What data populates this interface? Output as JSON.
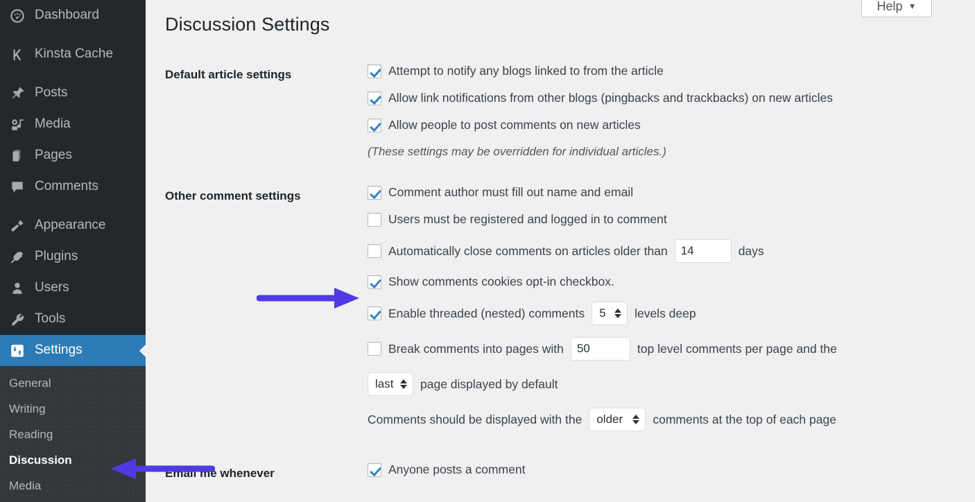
{
  "sidebar": {
    "items": [
      {
        "label": "Dashboard",
        "icon": "dashboard-icon",
        "current": false,
        "gap_after": true
      },
      {
        "label": "Kinsta Cache",
        "icon": "kinsta-k-icon",
        "current": false,
        "gap_after": true
      },
      {
        "label": "Posts",
        "icon": "pin-icon",
        "current": false,
        "gap_after": false
      },
      {
        "label": "Media",
        "icon": "media-icon",
        "current": false,
        "gap_after": false
      },
      {
        "label": "Pages",
        "icon": "pages-icon",
        "current": false,
        "gap_after": false
      },
      {
        "label": "Comments",
        "icon": "comment-icon",
        "current": false,
        "gap_after": true
      },
      {
        "label": "Appearance",
        "icon": "paintbrush-icon",
        "current": false,
        "gap_after": false
      },
      {
        "label": "Plugins",
        "icon": "plug-icon",
        "current": false,
        "gap_after": false
      },
      {
        "label": "Users",
        "icon": "user-icon",
        "current": false,
        "gap_after": false
      },
      {
        "label": "Tools",
        "icon": "wrench-icon",
        "current": false,
        "gap_after": false
      },
      {
        "label": "Settings",
        "icon": "sliders-icon",
        "current": true,
        "gap_after": false
      }
    ],
    "submenu": [
      {
        "label": "General",
        "active": false
      },
      {
        "label": "Writing",
        "active": false
      },
      {
        "label": "Reading",
        "active": false
      },
      {
        "label": "Discussion",
        "active": true
      },
      {
        "label": "Media",
        "active": false
      }
    ]
  },
  "header": {
    "help_label": "Help",
    "help_caret": "▼",
    "page_title": "Discussion Settings"
  },
  "sections": {
    "default_article": {
      "label": "Default article settings",
      "options": [
        {
          "text": "Attempt to notify any blogs linked to from the article",
          "checked": true
        },
        {
          "text": "Allow link notifications from other blogs (pingbacks and trackbacks) on new articles",
          "checked": true
        },
        {
          "text": "Allow people to post comments on new articles",
          "checked": true
        }
      ],
      "note": "(These settings may be overridden for individual articles.)"
    },
    "other_comment": {
      "label": "Other comment settings",
      "opt_author_fill": {
        "text": "Comment author must fill out name and email",
        "checked": true
      },
      "opt_registered": {
        "text": "Users must be registered and logged in to comment",
        "checked": false
      },
      "opt_autoclose": {
        "checked": false,
        "text_before": "Automatically close comments on articles older than",
        "days_value": "14",
        "text_after": "days"
      },
      "opt_cookies": {
        "text": "Show comments cookies opt-in checkbox.",
        "checked": true
      },
      "opt_threaded": {
        "checked": true,
        "text_before": "Enable threaded (nested) comments",
        "levels_value": "5",
        "text_after": "levels deep"
      },
      "opt_paging": {
        "checked": false,
        "text_before": "Break comments into pages with",
        "per_page_value": "50",
        "text_after": "top level comments per page and the"
      },
      "page_default": {
        "select_value": "last",
        "text_after": "page displayed by default"
      },
      "display_order": {
        "text_before": "Comments should be displayed with the",
        "select_value": "older",
        "text_after": "comments at the top of each page"
      }
    },
    "email_me": {
      "label": "Email me whenever",
      "first_option": {
        "text": "Anyone posts a comment",
        "checked": true
      }
    }
  },
  "annotations": {
    "arrow_color": "#4f3ae3",
    "arrow_right_target": "Show comments cookies opt-in checkbox.",
    "arrow_left_target": "Discussion"
  }
}
